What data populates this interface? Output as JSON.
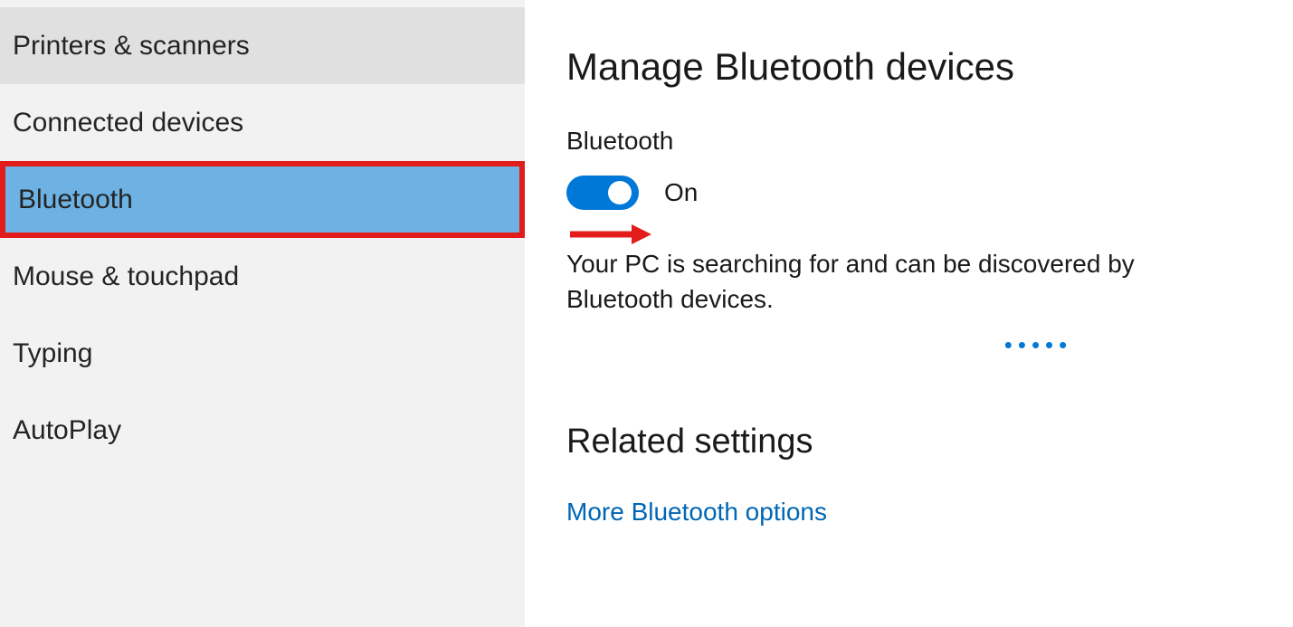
{
  "sidebar": {
    "items": [
      {
        "label": "Printers & scanners"
      },
      {
        "label": "Connected devices"
      },
      {
        "label": "Bluetooth"
      },
      {
        "label": "Mouse & touchpad"
      },
      {
        "label": "Typing"
      },
      {
        "label": "AutoPlay"
      }
    ],
    "selected_index": 2
  },
  "main": {
    "title": "Manage Bluetooth devices",
    "bluetooth": {
      "label": "Bluetooth",
      "state_text": "On",
      "is_on": true,
      "status": "Your PC is searching for and can be discovered by Bluetooth devices."
    },
    "related": {
      "heading": "Related settings",
      "more_bt_link": "More Bluetooth options"
    }
  },
  "colors": {
    "accent": "#0078d7",
    "annotation": "#e21b1b",
    "link": "#0066b4"
  }
}
